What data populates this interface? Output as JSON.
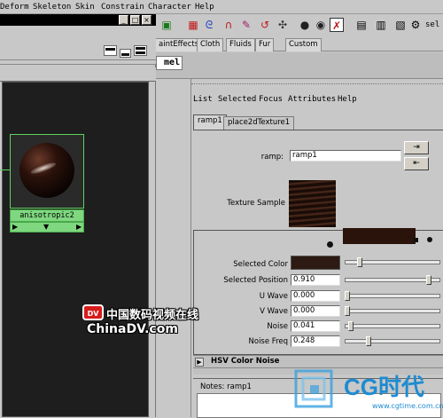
{
  "menubar": {
    "items": [
      "Deform",
      "Skeleton",
      "Skin",
      "Constrain",
      "Character",
      "Help"
    ]
  },
  "hypershade": {
    "window_buttons": [
      "_",
      "□",
      "×"
    ],
    "node": {
      "label": "anisotropic2",
      "ports": [
        "▶",
        "▼",
        "▶"
      ]
    }
  },
  "shelf": {
    "tabs": [
      "aintEffects",
      "Cloth",
      "Fluids",
      "Fur",
      "Custom"
    ],
    "mel_label": "mel",
    "dropdown_label": "sel"
  },
  "attribute_editor": {
    "menu": [
      "List",
      "Selected",
      "Focus",
      "Attributes",
      "Help"
    ],
    "tabs": [
      "ramp1",
      "place2dTexture1"
    ],
    "ramp_label": "ramp:",
    "ramp_value": "ramp1",
    "texture_sample_label": "Texture Sample",
    "attributes": [
      {
        "label": "Selected Color",
        "value": ""
      },
      {
        "label": "Selected Position",
        "value": "0.910"
      },
      {
        "label": "U Wave",
        "value": "0.000"
      },
      {
        "label": "V Wave",
        "value": "0.000"
      },
      {
        "label": "Noise",
        "value": "0.041"
      },
      {
        "label": "Noise Freq",
        "value": "0.248"
      }
    ],
    "hsv_frame_label": "HSV Color Noise",
    "notes_label": "Notes: ramp1",
    "colors": {
      "selected_color": "#2d1a12",
      "texture_dark": "#1a0c07",
      "texture_light": "#4a2a1c"
    }
  },
  "watermarks": {
    "chinadv_logo": "DV",
    "chinadv_cn": "中国数码视频在线",
    "chinadv_en": "ChinaDV.com",
    "cg_text": "CG时代",
    "cg_url": "www.cgtime.com.cn"
  }
}
